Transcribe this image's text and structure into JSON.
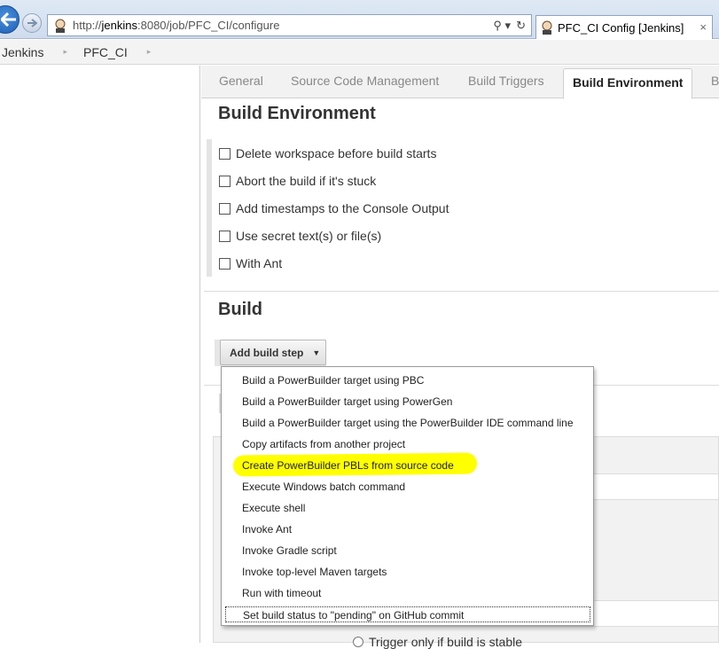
{
  "browser": {
    "url_prefix": "http://",
    "url_host": "jenkins",
    "url_rest": ":8080/job/PFC_CI/configure",
    "search_glyph": "⚲ ▾",
    "refresh_glyph": "↻",
    "tab_title": "PFC_CI Config [Jenkins]",
    "tab_close": "×"
  },
  "breadcrumb": {
    "items": [
      "Jenkins",
      "PFC_CI"
    ],
    "separator": "▸"
  },
  "config_tabs": {
    "general": "General",
    "scm": "Source Code Management",
    "triggers": "Build Triggers",
    "environment": "Build Environment",
    "next_partial": "B"
  },
  "build_environment": {
    "title": "Build Environment",
    "options": [
      "Delete workspace before build starts",
      "Abort the build if it's stuck",
      "Add timestamps to the Console Output",
      "Use secret text(s) or file(s)",
      "With Ant"
    ]
  },
  "build": {
    "title": "Build",
    "add_step_label": "Add build step",
    "caret": "▼"
  },
  "add_step_menu": {
    "items": [
      "Build a PowerBuilder target using PBC",
      "Build a PowerBuilder target using PowerGen",
      "Build a PowerBuilder target using the PowerBuilder IDE command line",
      "Copy artifacts from another project",
      "Create PowerBuilder PBLs from source code",
      "Execute Windows batch command",
      "Execute shell",
      "Invoke Ant",
      "Invoke Gradle script",
      "Invoke top-level Maven targets",
      "Run with timeout",
      "Set build status to \"pending\" on GitHub commit"
    ],
    "highlighted_color": "#ffff00"
  },
  "background": {
    "trigger_text": "Trigger only if build is stable"
  }
}
